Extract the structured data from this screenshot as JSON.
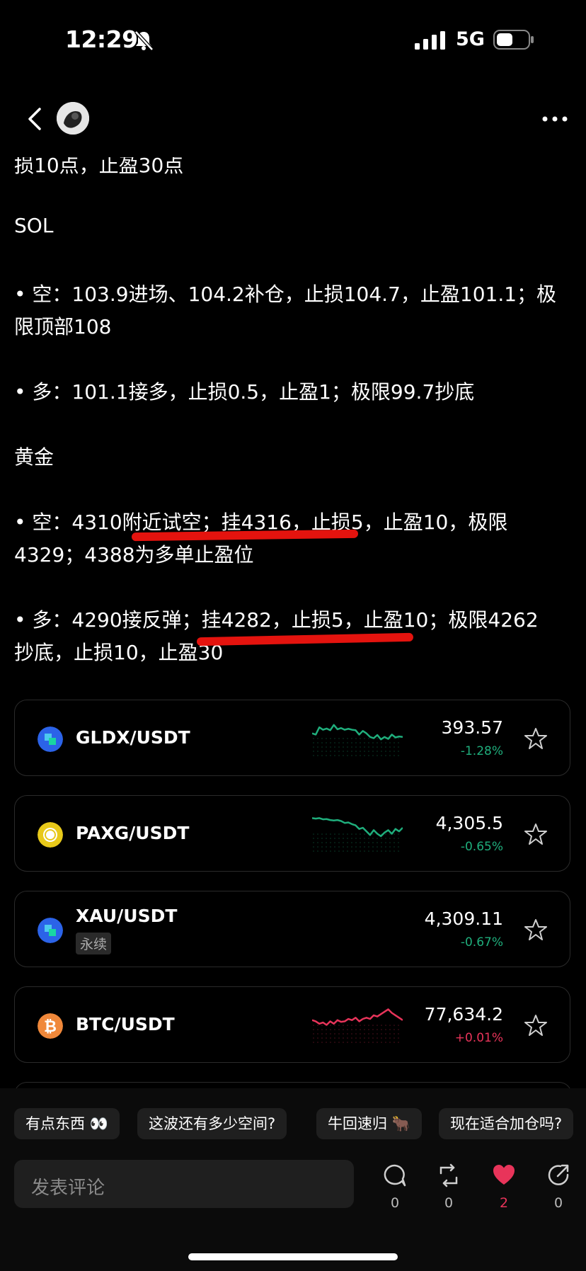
{
  "status_bar": {
    "time": "12:29",
    "network": "5G"
  },
  "post": {
    "lines": [
      "损10点，止盈30点",
      "SOL",
      "• 空：103.9进场、104.2补仓，止损104.7，止盈101.1；极",
      "限顶部108",
      "• 多：101.1接多，止损0.5，止盈1；极限99.7抄底",
      "黄金",
      "• 空：4310附近试空；挂4316，止损5，止盈10，极限",
      "4329；4388为多单止盈位",
      "• 多：4290接反弹；挂4282，止损5，止盈10；极限4262",
      "抄底，止损10，止盈30"
    ]
  },
  "markets": [
    {
      "pair": "GLDX/USDT",
      "price": "393.57",
      "change": "-1.28%",
      "trend": "down",
      "tag": "",
      "icon": "gldx-coin-icon",
      "spark": [
        0.55,
        0.6,
        0.3,
        0.4,
        0.35,
        0.42,
        0.2,
        0.38,
        0.33,
        0.4,
        0.36,
        0.4,
        0.42,
        0.6,
        0.45,
        0.55,
        0.7,
        0.75,
        0.62,
        0.8,
        0.7,
        0.78,
        0.6,
        0.72,
        0.68,
        0.7
      ]
    },
    {
      "pair": "PAXG/USDT",
      "price": "4,305.5",
      "change": "-0.65%",
      "trend": "down",
      "tag": "",
      "icon": "paxg-coin-icon",
      "spark": [
        0.1,
        0.12,
        0.1,
        0.15,
        0.14,
        0.18,
        0.2,
        0.18,
        0.22,
        0.3,
        0.28,
        0.35,
        0.4,
        0.55,
        0.5,
        0.65,
        0.8,
        0.6,
        0.75,
        0.85,
        0.7,
        0.6,
        0.75,
        0.55,
        0.65,
        0.5
      ]
    },
    {
      "pair": "XAU/USDT",
      "price": "4,309.11",
      "change": "-0.67%",
      "trend": "down",
      "tag": "永续",
      "icon": "xau-coin-icon",
      "spark": []
    },
    {
      "pair": "BTC/USDT",
      "price": "77,634.2",
      "change": "+0.01%",
      "trend": "up",
      "tag": "",
      "icon": "btc-coin-icon",
      "spark": [
        0.55,
        0.6,
        0.7,
        0.65,
        0.75,
        0.6,
        0.7,
        0.55,
        0.62,
        0.6,
        0.5,
        0.55,
        0.45,
        0.6,
        0.5,
        0.45,
        0.5,
        0.35,
        0.4,
        0.3,
        0.2,
        0.1,
        0.25,
        0.35,
        0.45,
        0.55
      ]
    }
  ],
  "chips": [
    "有点东西 👀",
    "这波还有多少空间?",
    "牛回速归 🐂",
    "现在适合加仓吗?"
  ],
  "comment": {
    "placeholder": "发表评论"
  },
  "actions": {
    "comments": "0",
    "reposts": "0",
    "likes": "2",
    "shares": "0"
  },
  "colors": {
    "up": "#e8345a",
    "down": "#1fae7c",
    "accent_red": "#e4130e",
    "like": "#e8345a"
  }
}
